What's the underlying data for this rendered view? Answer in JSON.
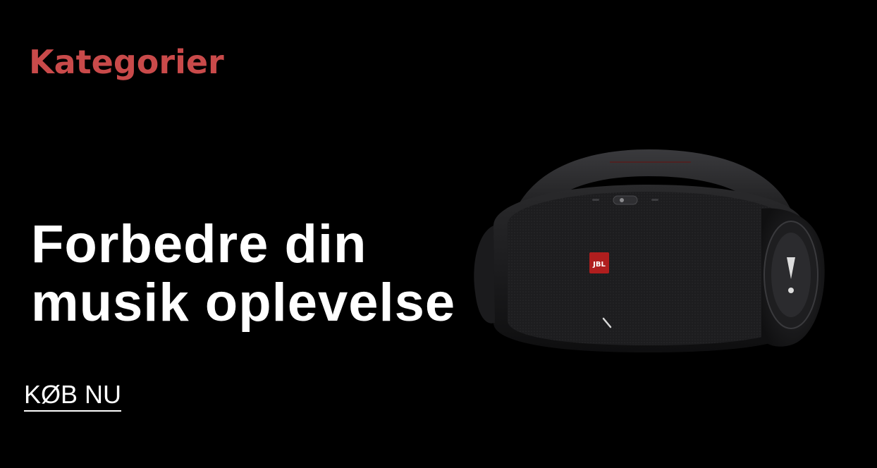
{
  "category": {
    "title": "Kategorier"
  },
  "hero": {
    "headline_line1": "Forbedre din",
    "headline_line2": "musik oplevelse",
    "cta_label": "KØB NU"
  },
  "product": {
    "brand": "JBL",
    "icon": "speaker-image"
  },
  "colors": {
    "background": "#000000",
    "accent": "#c94a4a",
    "text": "#ffffff",
    "badge": "#b01e1e"
  }
}
